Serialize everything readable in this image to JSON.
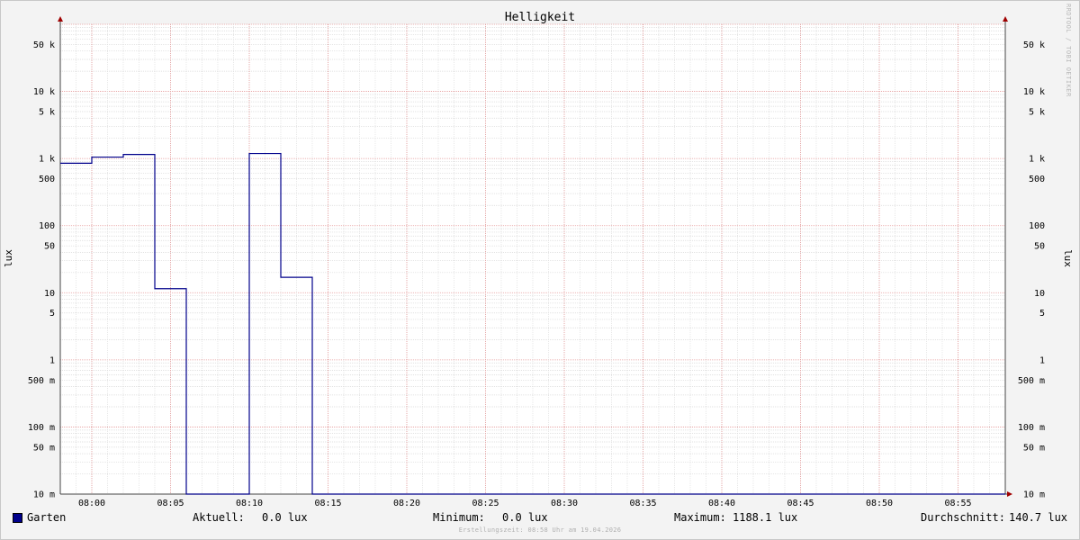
{
  "chart_data": {
    "type": "line",
    "title": "Helligkeit",
    "ylabel": "lux",
    "y_scale": "log",
    "ylim": [
      0.01,
      100000
    ],
    "y_ticks": [
      {
        "value": 50000,
        "label": "50 k"
      },
      {
        "value": 10000,
        "label": "10 k"
      },
      {
        "value": 5000,
        "label": "5 k"
      },
      {
        "value": 1000,
        "label": "1 k"
      },
      {
        "value": 500,
        "label": "500"
      },
      {
        "value": 100,
        "label": "100"
      },
      {
        "value": 50,
        "label": "50"
      },
      {
        "value": 10,
        "label": "10"
      },
      {
        "value": 5,
        "label": "5"
      },
      {
        "value": 1,
        "label": "1"
      },
      {
        "value": 0.5,
        "label": "500 m"
      },
      {
        "value": 0.1,
        "label": "100 m"
      },
      {
        "value": 0.05,
        "label": "50 m"
      },
      {
        "value": 0.01,
        "label": "10 m"
      }
    ],
    "xlim": [
      "07:58",
      "08:58"
    ],
    "x_ticks": [
      "08:00",
      "08:05",
      "08:10",
      "08:15",
      "08:20",
      "08:25",
      "08:30",
      "08:35",
      "08:40",
      "08:45",
      "08:50",
      "08:55"
    ],
    "grid": true,
    "series": [
      {
        "name": "Garten",
        "color": "#00008b",
        "steps": [
          {
            "start": "07:58",
            "end": "08:00",
            "value": 850
          },
          {
            "start": "08:00",
            "end": "08:02",
            "value": 1050
          },
          {
            "start": "08:02",
            "end": "08:04",
            "value": 1150
          },
          {
            "start": "08:04",
            "end": "08:06",
            "value": 11.5
          },
          {
            "start": "08:06",
            "end": "08:10",
            "value": 0
          },
          {
            "start": "08:10",
            "end": "08:12",
            "value": 1188.1
          },
          {
            "start": "08:12",
            "end": "08:14",
            "value": 17
          },
          {
            "start": "08:14",
            "end": "08:58",
            "value": 0
          }
        ]
      }
    ]
  },
  "legend": {
    "series_name": "Garten",
    "current_label": "Aktuell:",
    "current_value": "0.0 lux",
    "min_label": "Minimum:",
    "min_value": "0.0 lux",
    "max_label": "Maximum:",
    "max_value": "1188.1 lux",
    "avg_label": "Durchschnitt:",
    "avg_value": "140.7 lux"
  },
  "footer": "Erstellungszeit: 08:58 Uhr am 19.04.2026",
  "watermark": "RRDTOOL / TOBI OETIKER"
}
